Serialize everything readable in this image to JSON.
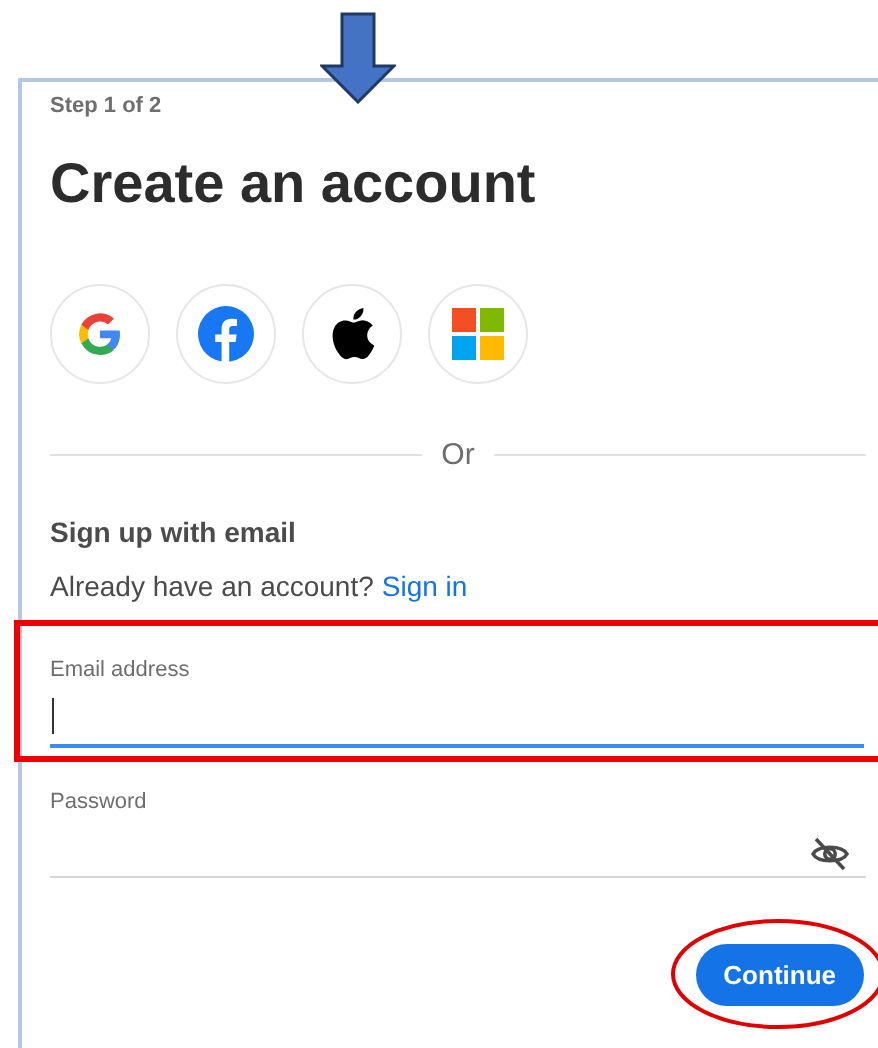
{
  "step": "Step 1 of 2",
  "title": "Create an account",
  "social_buttons": [
    {
      "kind": "google"
    },
    {
      "kind": "facebook"
    },
    {
      "kind": "apple"
    },
    {
      "kind": "microsoft"
    }
  ],
  "divider": "Or",
  "section_heading": "Sign up with email",
  "prompt": {
    "text": "Already have an account?",
    "link": "Sign in"
  },
  "fields": [
    {
      "kind": "email",
      "label": "Email address",
      "focused": true
    },
    {
      "kind": "password",
      "label": "Password",
      "focused": false
    }
  ],
  "button": "Continue",
  "annotations": [
    {
      "kind": "arrow"
    },
    {
      "kind": "box"
    },
    {
      "kind": "ellipse"
    }
  ]
}
